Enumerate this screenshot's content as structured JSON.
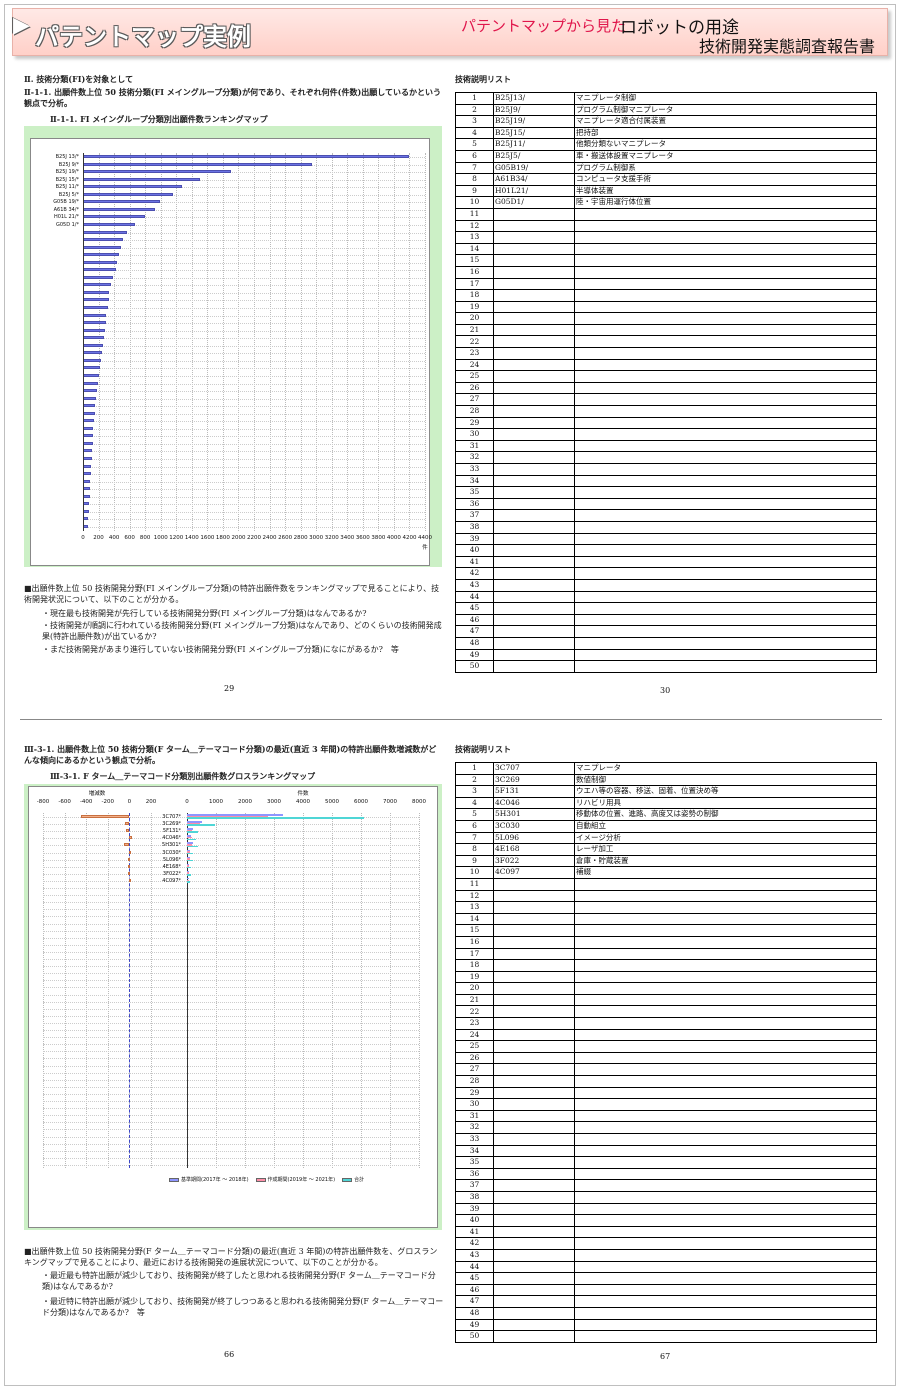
{
  "banner": {
    "title": "パテントマップ実例",
    "subtitle": "パテントマップから見た",
    "topic": "ロボットの用途",
    "report": "技術開発実態調査報告書"
  },
  "page1": {
    "section": "Ⅱ. 技術分類(FI)を対象として",
    "heading": "Ⅱ-1-1. 出願件数上位 50 技術分類(FI メイングループ分類)が何であり、それぞれ何件(件数)出願しているかという観点で分析。",
    "chart_title": "Ⅱ-1-1. FI メイングループ分類別出願件数ランキングマップ",
    "note_title": "■出願件数上位 50 技術開発分野(FI メイングループ分類)の特許出願件数をランキングマップで見ることにより、技術開発状況について、以下のことが分かる。",
    "bullets": [
      "・現在最も技術開発が先行している技術開発分野(FI メイングループ分類)はなんであるか?",
      "・技術開発が順調に行われている技術開発分野(FI メイングループ分類)はなんであり、どのくらいの技術開発成果(特許出願件数)が出ているか?",
      "・まだ技術開発があまり進行していない技術開発分野(FI メイングループ分類)になにがあるか?　等"
    ],
    "page_left": "29",
    "page_right": "30",
    "list_title": "技術説明リスト",
    "rows": [
      [
        "1",
        "B25J13/",
        "マニプレータ制御"
      ],
      [
        "2",
        "B25J9/",
        "プログラム制御マニプレータ"
      ],
      [
        "3",
        "B25J19/",
        "マニプレータ適合付属装置"
      ],
      [
        "4",
        "B25J15/",
        "把持部"
      ],
      [
        "5",
        "B25J11/",
        "他類分類ないマニプレータ"
      ],
      [
        "6",
        "B25J5/",
        "車・搬送体設置マニプレータ"
      ],
      [
        "7",
        "G05B19/",
        "プログラム制御系"
      ],
      [
        "8",
        "A61B34/",
        "コンピュータ支援手術"
      ],
      [
        "9",
        "H01L21/",
        "半導体装置"
      ],
      [
        "10",
        "G05D1/",
        "陸・宇宙用運行体位置"
      ]
    ]
  },
  "page2": {
    "heading": "Ⅲ-3-1. 出願件数上位 50 技術分類(F ターム＿テーマコード分類)の最近(直近 3 年間)の特許出願件数増減数がどんな傾向にあるかという観点で分析。",
    "chart_title": "Ⅲ-3-1. F ターム＿テーマコード分類別出願件数グロスランキングマップ",
    "note_title": "■出願件数上位 50 技術開発分野(F ターム＿テーマコード分類)の最近(直近 3 年間)の特許出願件数を、グロスランキングマップで見ることにより、最近における技術開発の進展状況について、以下のことが分かる。",
    "bullets": [
      "・最近最も特許出願が減少しており、技術開発が終了したと思われる技術開発分野(F ターム＿テーマコード分類)はなんであるか?",
      "・最近特に特許出願が減少しており、技術開発が終了しつつあると思われる技術開発分野(F ターム＿テーマコード分類)はなんであるか?　等"
    ],
    "page_left": "66",
    "page_right": "67",
    "list_title": "技術説明リスト",
    "rows": [
      [
        "1",
        "3C707",
        "マニプレータ"
      ],
      [
        "2",
        "3C269",
        "数値制御"
      ],
      [
        "3",
        "5F131",
        "ウエハ等の容器、移送、固着、位置決め等"
      ],
      [
        "4",
        "4C046",
        "リハビリ用具"
      ],
      [
        "5",
        "5H301",
        "移動体の位置、進路、高度又は姿勢の制御"
      ],
      [
        "6",
        "3C030",
        "自動組立"
      ],
      [
        "7",
        "5L096",
        "イメージ分析"
      ],
      [
        "8",
        "4E168",
        "レーザ加工"
      ],
      [
        "9",
        "3F022",
        "倉庫・貯蔵装置"
      ],
      [
        "10",
        "4C097",
        "補綴"
      ]
    ],
    "legend": [
      "基準期間(2017年 ～ 2018年)",
      "作成期間(2019年 ～ 2021年)",
      "合計"
    ],
    "left_axis_label": "増減数",
    "right_axis_label": "件数"
  },
  "chart_data": [
    {
      "type": "bar",
      "title": "Ⅱ-1-1. FI メイングループ分類別出願件数ランキングマップ",
      "xlabel": "件",
      "categories": [
        "B25J 13/*",
        "B25J 9/*",
        "B25J 19/*",
        "B25J 15/*",
        "B25J 11/*",
        "B25J 5/*",
        "G05B 19/*",
        "A61B 34/*",
        "H01L 21/*",
        "G05D 1/*"
      ],
      "values": [
        4200,
        2950,
        1900,
        1500,
        1280,
        1160,
        990,
        920,
        800,
        670
      ],
      "rest": [
        570,
        520,
        490,
        460,
        440,
        420,
        380,
        360,
        340,
        330,
        320,
        300,
        290,
        280,
        270,
        255,
        240,
        230,
        220,
        200,
        190,
        180,
        170,
        160,
        150,
        140,
        135,
        130,
        125,
        120,
        110,
        105,
        100,
        95,
        90,
        85,
        80,
        75,
        70,
        65
      ],
      "xlim": [
        0,
        4400
      ],
      "xticks": [
        0,
        200,
        400,
        600,
        800,
        1000,
        1200,
        1400,
        1600,
        1800,
        2000,
        2200,
        2400,
        2600,
        2800,
        3000,
        3200,
        3400,
        3600,
        3800,
        4000,
        4200,
        4400
      ],
      "grid": true
    },
    {
      "type": "bar",
      "title": "Ⅲ-3-1. F ターム＿テーマコード分類別出願件数グロスランキングマップ",
      "categories": [
        "3C707",
        "3C269",
        "5F131",
        "4C046",
        "5H301",
        "3C030",
        "5L096",
        "4E168",
        "3F022",
        "4C097"
      ],
      "change": [
        -450,
        -40,
        -30,
        20,
        -50,
        10,
        -15,
        -10,
        -10,
        -5
      ],
      "series": [
        {
          "name": "基準期間(2017年 ～ 2018年)",
          "values": [
            3300,
            500,
            200,
            150,
            220,
            100,
            120,
            80,
            70,
            60
          ]
        },
        {
          "name": "作成期間(2019年 ～ 2021年)",
          "values": [
            2800,
            450,
            170,
            170,
            170,
            110,
            100,
            70,
            60,
            55
          ]
        },
        {
          "name": "合計",
          "values": [
            6100,
            950,
            370,
            320,
            390,
            210,
            220,
            150,
            130,
            115
          ]
        }
      ],
      "left_xlim": [
        -800,
        200
      ],
      "left_xticks": [
        -800,
        -600,
        -400,
        -200,
        0,
        200
      ],
      "right_xlim": [
        0,
        8000
      ],
      "right_xticks": [
        0,
        1000,
        2000,
        3000,
        4000,
        5000,
        6000,
        7000,
        8000
      ]
    }
  ]
}
